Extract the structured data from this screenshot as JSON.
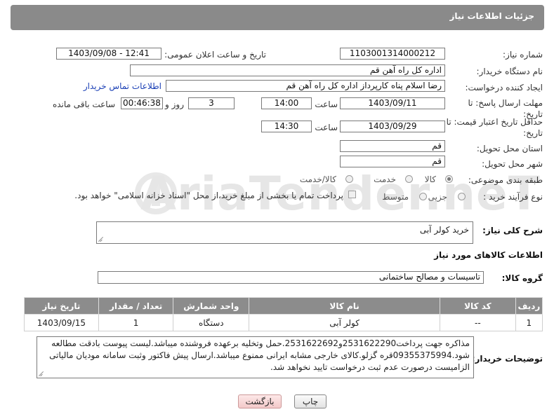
{
  "panel": {
    "title": "جزئیات اطلاعات نیاز"
  },
  "watermark": "AriaTender.neT",
  "form": {
    "need_number_label": "شماره نیاز:",
    "need_number": "1103001314000212",
    "announce_label": "تاریخ و ساعت اعلان عمومی:",
    "announce_value": "1403/09/08 - 12:41",
    "buyer_org_label": "نام دستگاه خریدار:",
    "buyer_org": "اداره کل  راه آهن قم",
    "creator_label": "ایجاد کننده درخواست:",
    "creator": "رضا اسلام پناه کارپرداز اداره کل  راه آهن قم",
    "contact_link": "اطلاعات تماس خریدار",
    "deadline_label": "مهلت ارسال پاسخ: تا تاریخ:",
    "deadline_date": "1403/09/11",
    "time_label": "ساعت",
    "deadline_time": "14:00",
    "days_value": "3",
    "days_label": "روز و",
    "remaining_value": "00:46:38",
    "remaining_label": "ساعت باقی مانده",
    "validity_label": "حداقل تاریخ اعتبار قیمت: تا تاریخ:",
    "validity_date": "1403/09/29",
    "validity_time_label": "ساعت",
    "validity_time": "14:30",
    "province_label": "استان محل تحویل:",
    "province": "قم",
    "city_label": "شهر محل تحویل:",
    "city": "قم",
    "category_label": "طبقه بندی موضوعی:",
    "category_options": [
      "کالا",
      "خدمت",
      "کالا/خدمت"
    ],
    "process_label": "نوع فرآیند خرید :",
    "process_options": [
      "جزیی",
      "متوسط"
    ],
    "payment_note": "پرداخت تمام یا بخشی از مبلغ خرید،از محل \"اسناد خزانه اسلامی\" خواهد بود."
  },
  "description": {
    "label": "شرح کلی نیاز:",
    "value": "خرید کولر آبی"
  },
  "goods_section": {
    "title": "اطلاعات کالاهای مورد نیاز",
    "group_label": "گروه کالا:",
    "group_value": "تاسیسات و مصالح ساختمانی"
  },
  "table": {
    "headers": [
      "ردیف",
      "کد کالا",
      "نام کالا",
      "واحد شمارش",
      "تعداد / مقدار",
      "تاریخ نیاز"
    ],
    "rows": [
      [
        "1",
        "--",
        "کولر آبی",
        "دستگاه",
        "1",
        "1403/09/15"
      ]
    ]
  },
  "buyer_notes": {
    "label": "توضیحات خریدار:",
    "value": "مذاکره جهت پرداخت2531622290و2531622692.حمل وتخلیه برعهده فروشنده میباشد.لیست پیوست بادقت مطالعه شود.09355375994قره گزلو.کالای خارجی مشابه ایرانی ممنوع میباشد.ارسال پیش فاکتور وثبت سامانه مودیان مالیاتی الزامیست درصورت عدم ثبت درخواست تایید نخواهد شد."
  },
  "buttons": {
    "print": "چاپ",
    "back": "بازگشت"
  }
}
